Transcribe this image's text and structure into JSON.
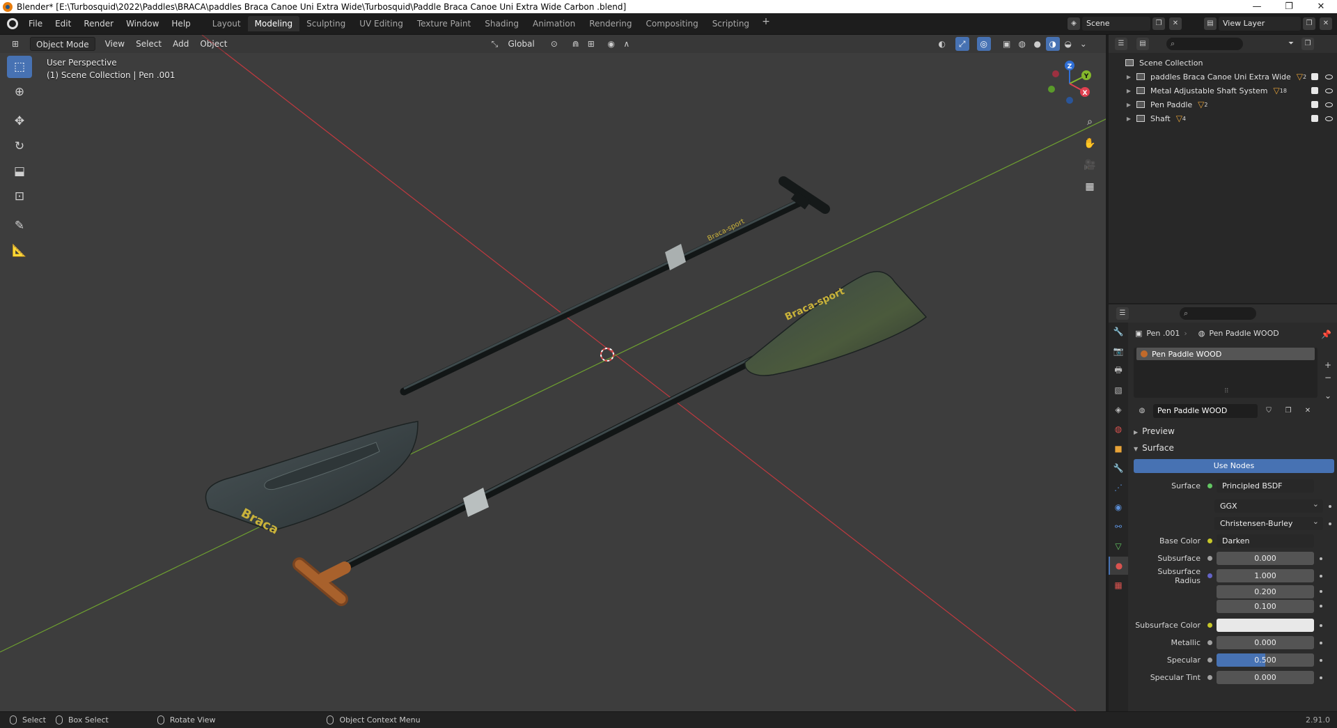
{
  "window": {
    "title": "Blender* [E:\\Turbosquid\\2022\\Paddles\\BRACA\\paddles Braca Canoe Uni Extra Wide\\Turbosquid\\Paddle Braca Canoe Uni Extra Wide  Carbon .blend]",
    "minimize": "—",
    "maximize": "❐",
    "close": "✕"
  },
  "menu": [
    "File",
    "Edit",
    "Render",
    "Window",
    "Help"
  ],
  "workspaces": [
    "Layout",
    "Modeling",
    "Sculpting",
    "UV Editing",
    "Texture Paint",
    "Shading",
    "Animation",
    "Rendering",
    "Compositing",
    "Scripting"
  ],
  "active_workspace": "Modeling",
  "scene": {
    "name": "Scene"
  },
  "view_layer": {
    "name": "View Layer"
  },
  "viewport": {
    "mode": "Object Mode",
    "menus": [
      "View",
      "Select",
      "Add",
      "Object"
    ],
    "transform_orientation": "Global",
    "overlay_line1": "User Perspective",
    "overlay_line2": "(1) Scene Collection | Pen .001",
    "gizmo": {
      "z": "Z",
      "y": "Y",
      "x": "X"
    },
    "colors": {
      "background": "#3d3d3d",
      "x_axis": "#c0393f",
      "y_axis": "#6ea030"
    }
  },
  "outliner": {
    "root": "Scene Collection",
    "items": [
      {
        "label": "paddles Braca Canoe Uni Extra Wide",
        "count": "2"
      },
      {
        "label": "Metal Adjustable Shaft System",
        "count": "18"
      },
      {
        "label": "Pen Paddle",
        "count": "2"
      },
      {
        "label": "Shaft",
        "count": "4"
      }
    ]
  },
  "properties": {
    "object_name": "Pen .001",
    "material_name": "Pen Paddle WOOD",
    "slot_name": "Pen Paddle WOOD",
    "datablock_name": "Pen Paddle WOOD",
    "panels": {
      "preview": "Preview",
      "surface": "Surface"
    },
    "use_nodes": "Use Nodes",
    "surface_label": "Surface",
    "surface_value": "Principled BSDF",
    "distribution": "GGX",
    "subsurface_method": "Christensen-Burley",
    "rows": {
      "base_color": {
        "label": "Base Color",
        "value": "Darken"
      },
      "subsurface": {
        "label": "Subsurface",
        "value": "0.000"
      },
      "subsurface_radius": {
        "label": "Subsurface Radius",
        "values": [
          "1.000",
          "0.200",
          "0.100"
        ]
      },
      "subsurface_color": {
        "label": "Subsurface Color"
      },
      "metallic": {
        "label": "Metallic",
        "value": "0.000"
      },
      "specular": {
        "label": "Specular",
        "value": "0.500",
        "fraction": 0.5
      },
      "specular_tint": {
        "label": "Specular Tint",
        "value": "0.000"
      }
    }
  },
  "statusbar": {
    "select": "Select",
    "box_select": "Box Select",
    "rotate_view": "Rotate View",
    "context_menu": "Object Context Menu",
    "version": "2.91.0"
  }
}
